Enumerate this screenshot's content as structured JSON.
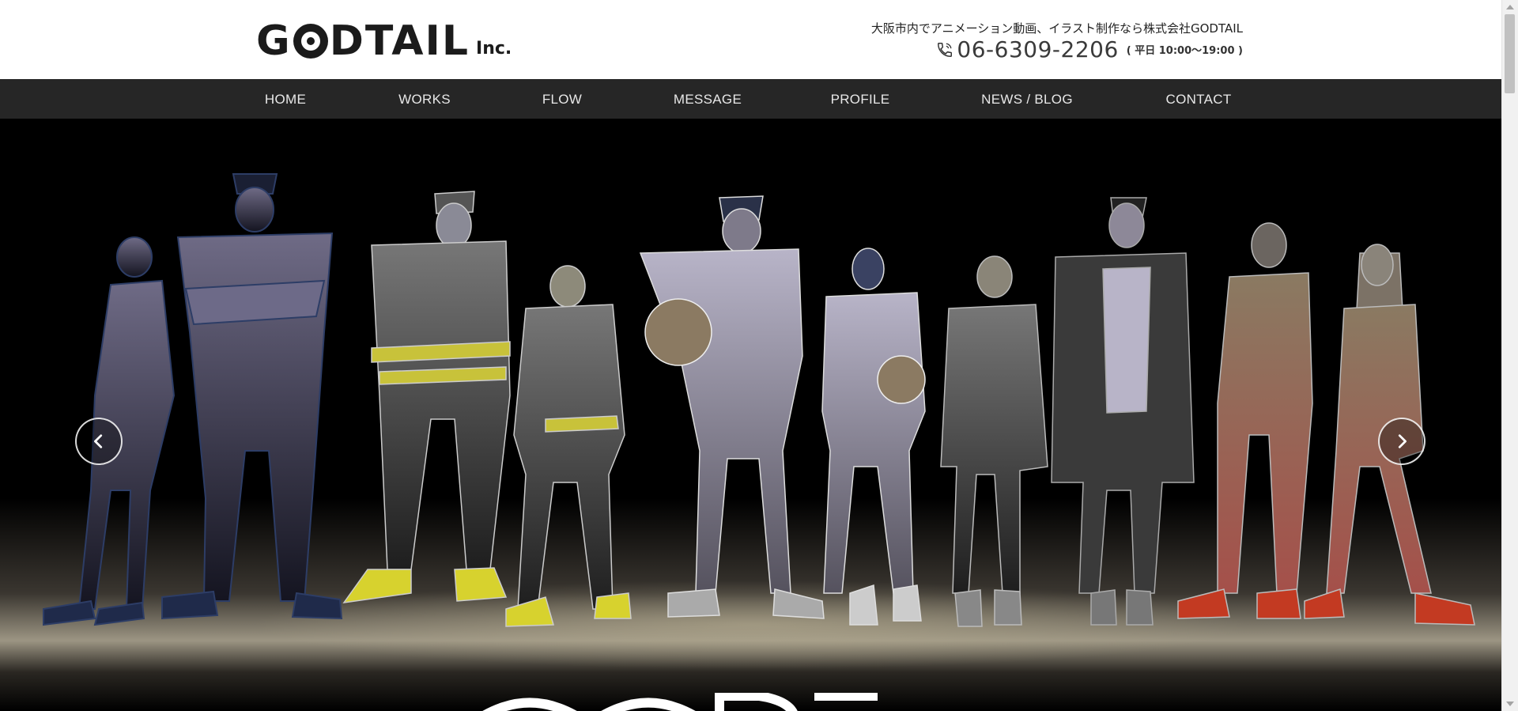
{
  "header": {
    "logo_text": "GODTAIL",
    "logo_suffix": "Inc.",
    "tagline": "大阪市内でアニメーション動画、イラスト制作なら株式会社GODTAIL",
    "phone_number": "06-6309-2206",
    "phone_hours": "( 平日 10:00〜19:00 )"
  },
  "nav": {
    "items": [
      {
        "label": "HOME"
      },
      {
        "label": "WORKS"
      },
      {
        "label": "FLOW"
      },
      {
        "label": "MESSAGE"
      },
      {
        "label": "PROFILE"
      },
      {
        "label": "NEWS / BLOG"
      },
      {
        "label": "CONTACT"
      }
    ]
  },
  "hero": {
    "prev_icon": "chevron-left-icon",
    "next_icon": "chevron-right-icon"
  },
  "colors": {
    "header_bg": "#ffffff",
    "nav_bg": "#262626",
    "nav_text": "#e8e8e8",
    "hero_bg": "#000000"
  }
}
